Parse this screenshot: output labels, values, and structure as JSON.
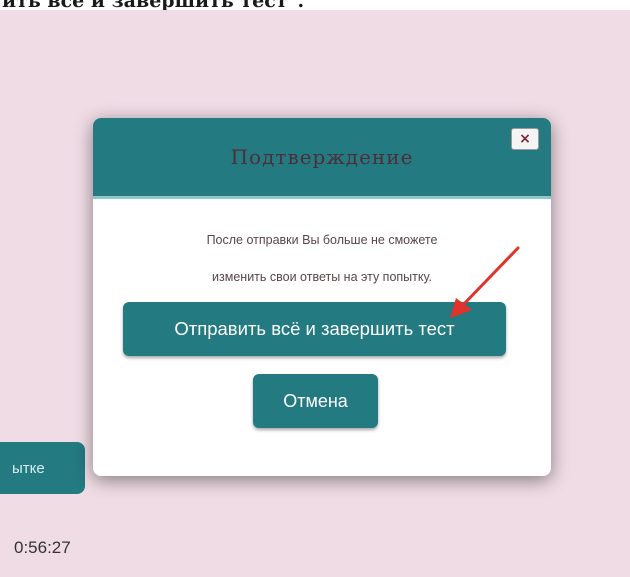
{
  "caption": "ить всё и завершить тест\".",
  "side_button": {
    "label": "ытке"
  },
  "timer": "0:56:27",
  "dialog": {
    "title": "Подтверждение",
    "close_label": "×",
    "message_line1": "После отправки Вы больше не сможете",
    "message_line2": "изменить свои ответы на эту попытку.",
    "submit_label": "Отправить всё и завершить тест",
    "cancel_label": "Отмена"
  },
  "colors": {
    "accent": "#237a80",
    "background": "#f0dce5",
    "annotation_arrow": "#e0332b"
  }
}
